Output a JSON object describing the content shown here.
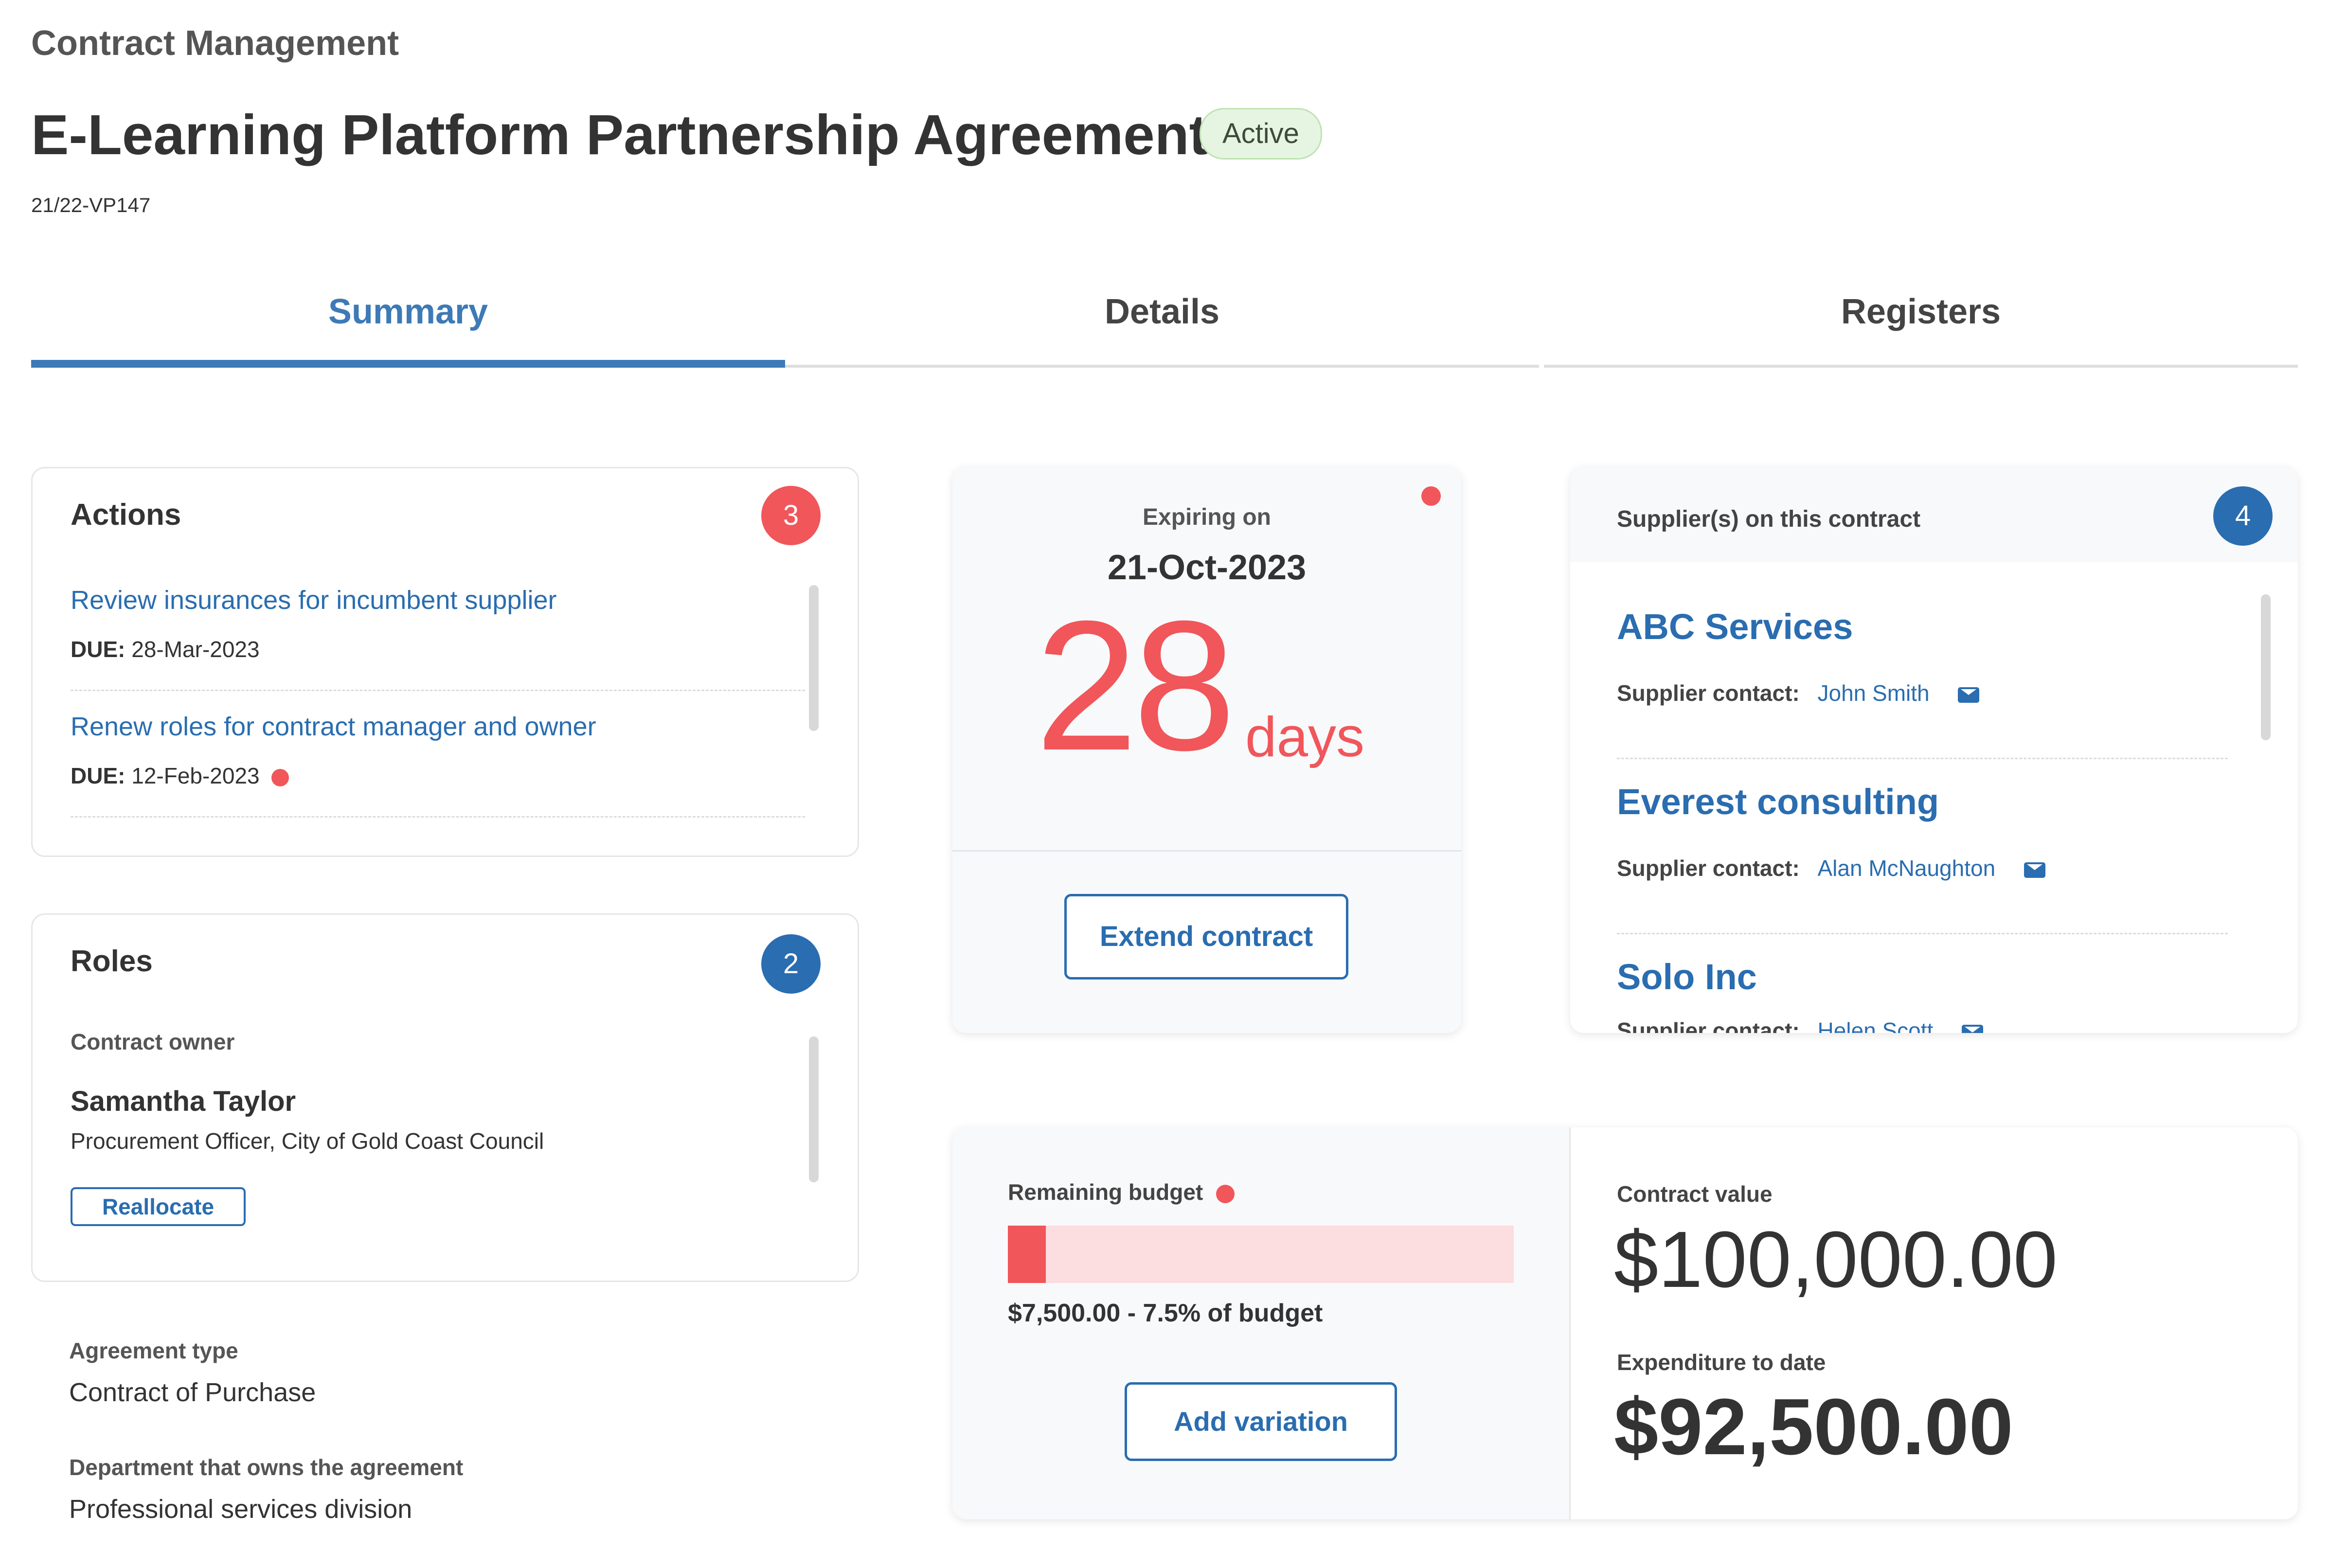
{
  "header": {
    "eyebrow": "Contract Management",
    "title": "E-Learning Platform Partnership Agreement",
    "status": "Active",
    "reference": "21/22-VP147"
  },
  "tabs": [
    {
      "label": "Summary",
      "active": true
    },
    {
      "label": "Details",
      "active": false
    },
    {
      "label": "Registers",
      "active": false
    }
  ],
  "actions": {
    "title": "Actions",
    "count": "3",
    "items": [
      {
        "label": "Review insurances for incumbent supplier",
        "due_label": "DUE:",
        "due_date": "28-Mar-2023",
        "overdue": false
      },
      {
        "label": "Renew roles for contract manager and owner",
        "due_label": "DUE:",
        "due_date": "12-Feb-2023",
        "overdue": true
      }
    ]
  },
  "roles": {
    "title": "Roles",
    "count": "2",
    "role_label": "Contract owner",
    "person_name": "Samantha Taylor",
    "person_position": "Procurement Officer, City of Gold Coast Council",
    "reallocate_label": "Reallocate"
  },
  "agreement": {
    "type_label": "Agreement type",
    "type_value": "Contract of Purchase",
    "department_label": "Department that owns the agreement",
    "department_value": "Professional services division"
  },
  "expiry": {
    "label": "Expiring on",
    "date": "21-Oct-2023",
    "days_number": "28",
    "days_unit": "days",
    "extend_label": "Extend contract"
  },
  "suppliers": {
    "title": "Supplier(s) on this contract",
    "count": "4",
    "contact_label": "Supplier contact:",
    "items": [
      {
        "name": "ABC Services",
        "contact": "John Smith"
      },
      {
        "name": "Everest consulting",
        "contact": "Alan McNaughton"
      },
      {
        "name": "Solo Inc",
        "contact": "Helen Scott"
      }
    ]
  },
  "budget": {
    "remaining_label": "Remaining budget",
    "remaining_fraction": 0.075,
    "remaining_text": "$7,500.00 - 7.5% of budget",
    "add_variation_label": "Add variation",
    "contract_value_label": "Contract value",
    "contract_value": "$100,000.00",
    "expenditure_label": "Expenditure to date",
    "expenditure": "$92,500.00"
  },
  "colors": {
    "accent": "#2a6db0",
    "alert": "#f0565a",
    "success_bg": "#e6f5e1",
    "budget_track": "#fcdde0"
  }
}
